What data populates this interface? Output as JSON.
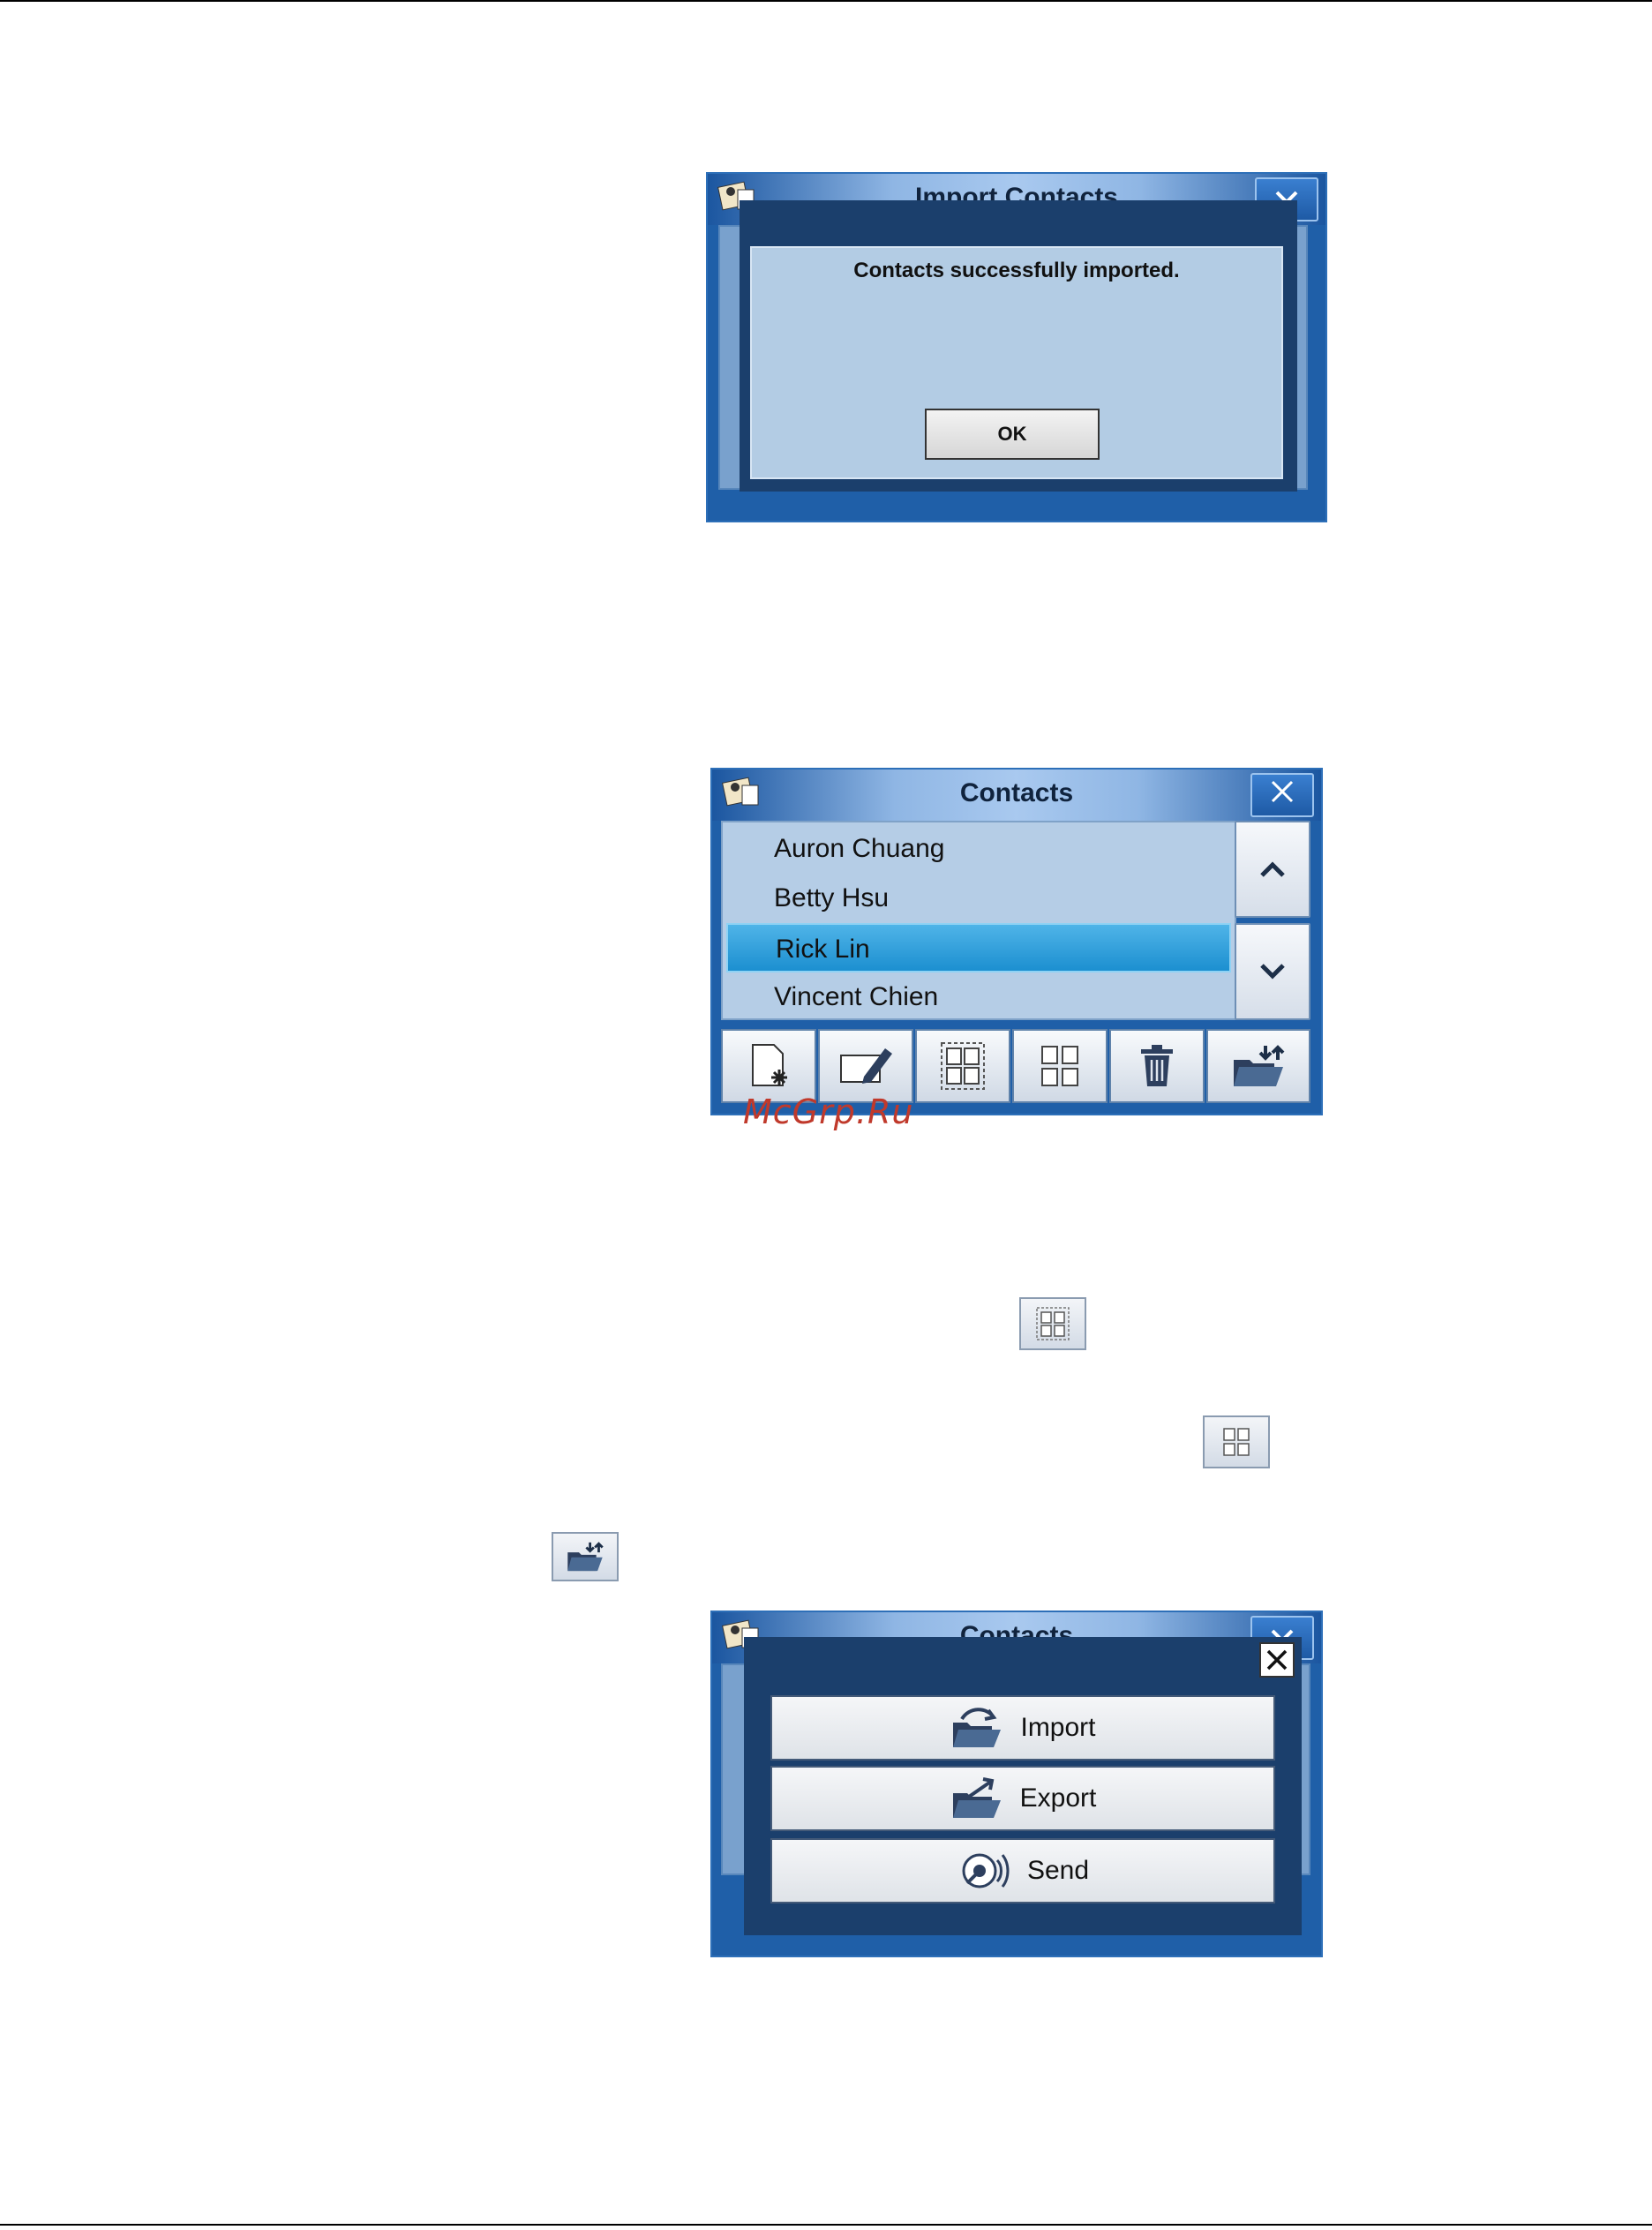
{
  "screen1": {
    "title": "Import Contacts",
    "dialog": {
      "message": "Contacts successfully imported.",
      "ok_label": "OK"
    }
  },
  "screen2": {
    "title": "Contacts",
    "contacts": [
      {
        "name": "Auron Chuang",
        "selected": false
      },
      {
        "name": "Betty Hsu",
        "selected": false
      },
      {
        "name": "Rick Lin",
        "selected": true
      },
      {
        "name": "Vincent Chien",
        "selected": false
      }
    ],
    "scroll_up_icon": "chevron-up-icon",
    "scroll_down_icon": "chevron-down-icon",
    "toolbar_icons": [
      "new-contact-icon",
      "edit-contact-icon",
      "select-all-icon",
      "deselect-all-icon",
      "trash-icon",
      "import-export-folder-icon"
    ]
  },
  "watermark": "McGrp.Ru",
  "screen3": {
    "title": "Contacts",
    "menu": [
      {
        "label": "Import",
        "icon": "import-folder-icon"
      },
      {
        "label": "Export",
        "icon": "export-folder-icon"
      },
      {
        "label": "Send",
        "icon": "send-icon"
      }
    ]
  },
  "colors": {
    "window_blue": "#1f5fa8",
    "list_bg": "#b5cde6",
    "selected_row": "#1c8fd0",
    "dialog_bg": "#b3cce4",
    "watermark": "#c0392b"
  }
}
